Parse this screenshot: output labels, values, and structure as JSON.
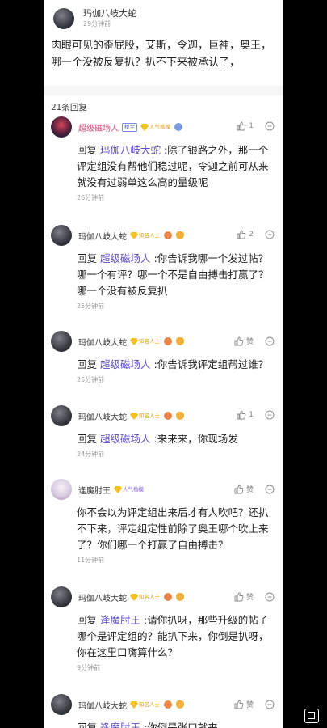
{
  "post": {
    "author": "玛伽八岐大蛇",
    "time": "29分钟前",
    "body": "肉眼可见的歪屁股，艾斯，令迦，巨神，奥王，哪一个没被反复扒？扒不下来被承认了，"
  },
  "reply_count": "21条回复",
  "replies": [
    {
      "name": "超级磁场人",
      "badge_floor": "楼主",
      "badge_gem": "人气楷模",
      "likes": "1",
      "reply_prefix": "回复",
      "reply_to": "玛伽八岐大蛇",
      "text": ":除了银路之外，那一个评定组没有帮他们稳过呢，令迦之前可从来就没有过弱单这么高的量级呢",
      "time": "26分钟前"
    },
    {
      "name": "玛伽八岐大蛇",
      "badge_gem": "知名人士",
      "likes": "2",
      "reply_prefix": "回复",
      "reply_to": "超级磁场人",
      "text": ":你告诉我哪一个发过帖？哪一个有评？哪一个不是自由搏击打赢了？哪一个没有被反复扒",
      "time": "25分钟前"
    },
    {
      "name": "玛伽八岐大蛇",
      "badge_gem": "知名人士",
      "likes": "赞",
      "reply_prefix": "回复",
      "reply_to": "超级磁场人",
      "text": ":你告诉我评定组帮过谁？",
      "time": "25分钟前"
    },
    {
      "name": "玛伽八岐大蛇",
      "badge_gem": "知名人士",
      "likes": "1",
      "reply_prefix": "回复",
      "reply_to": "超级磁场人",
      "text": ":来来来，你现场发",
      "time": "24分钟前"
    },
    {
      "name": "逢魔肘王",
      "badge_gem": "人气楷模",
      "likes": "赞",
      "text": "你不会以为评定组出来后才有人吹吧？还扒不下来，评定组定性前除了奥王哪个吹上来了？你们哪一个打赢了自由搏击？",
      "time": "11分钟前"
    },
    {
      "name": "玛伽八岐大蛇",
      "badge_gem": "知名人士",
      "likes": "赞",
      "reply_prefix": "回复",
      "reply_to": "逢魔肘王",
      "text": ":请你扒呀，那些升级的帖子哪个是评定组的？能扒下来，你倒是扒呀，你在这里口嗨算什么？",
      "time": "9分钟前"
    },
    {
      "name": "玛伽八岐大蛇",
      "badge_gem": "知名人士",
      "likes": "赞",
      "reply_prefix": "回复",
      "reply_to": "逢魔肘王",
      "text": ":你倒是张口就来"
    }
  ]
}
